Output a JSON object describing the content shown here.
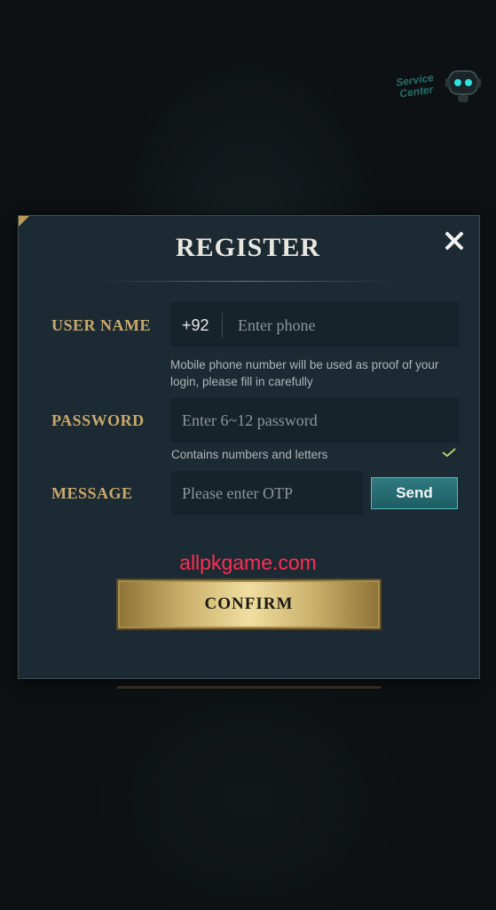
{
  "service_center": {
    "line1": "Service",
    "line2": "Center"
  },
  "modal": {
    "title": "REGISTER",
    "username_label": "USER NAME",
    "country_code": "+92",
    "phone_placeholder": "Enter phone",
    "phone_hint_line1": "Mobile phone number will be used as proof of your",
    "phone_hint_line2": "login, please fill in carefully",
    "password_label": "PASSWORD",
    "password_placeholder": "Enter 6~12 password",
    "password_hint": "Contains numbers and letters",
    "message_label": "MESSAGE",
    "otp_placeholder": "Please enter OTP",
    "send_label": "Send",
    "confirm_label": "CONFIRM"
  },
  "watermark": "allpkgame.com",
  "colors": {
    "accent_gold": "#c9a96a",
    "send_teal": "#2f7a80",
    "check_green": "#a8d46a",
    "watermark_red": "#ff2d55"
  },
  "icons": [
    "close-icon",
    "check-icon",
    "robot-icon"
  ]
}
